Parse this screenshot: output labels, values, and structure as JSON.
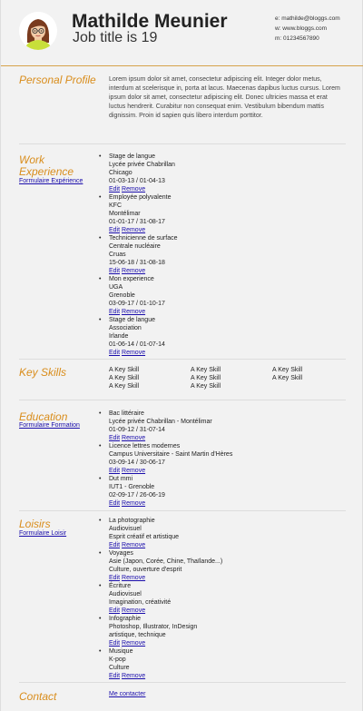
{
  "header": {
    "name": "Mathilde Meunier",
    "job_title": "Job title is 19",
    "email": "e: mathilde@bloggs.com",
    "website": "w: www.bloggs.com",
    "mobile": "m: 01234567890"
  },
  "profile": {
    "title": "Personal Profile",
    "text": "Lorem ipsum dolor sit amet, consectetur adipiscing elit. Integer dolor metus, interdum at scelerisque in, porta at lacus. Maecenas dapibus luctus cursus. Lorem ipsum dolor sit amet, consectetur adipiscing elit. Donec ultricies massa et erat luctus hendrerit. Curabitur non consequat enim. Vestibulum bibendum mattis dignissim. Proin id sapien quis libero interdum porttitor."
  },
  "experience": {
    "title_line1": "Work",
    "title_line2": "Experience",
    "form_link": "Formulaire Expérience",
    "edit_label": "Edit",
    "remove_label": "Remove",
    "items": [
      {
        "title": "Stage de langue",
        "org": "Lycée privée Chabrillan",
        "place": "Chicago",
        "dates": "01-03-13 / 01-04-13"
      },
      {
        "title": "Employée polyvalente",
        "org": "KFC",
        "place": "Montélimar",
        "dates": "01-01-17 / 31-08-17"
      },
      {
        "title": "Technicienne de surface",
        "org": "Centrale nucléaire",
        "place": "Cruas",
        "dates": "15-06-18 / 31-08-18"
      },
      {
        "title": "Mon experience",
        "org": "UGA",
        "place": "Grenoble",
        "dates": "03-09-17 / 01-10-17"
      },
      {
        "title": "Stage de langue",
        "org": "Association",
        "place": "Irlande",
        "dates": "01-06-14 / 01-07-14"
      }
    ]
  },
  "skills": {
    "title": "Key Skills",
    "items": [
      "A Key Skill",
      "A Key Skill",
      "A Key Skill",
      "A Key Skill",
      "A Key Skill",
      "A Key Skill",
      "A Key Skill",
      "A Key Skill"
    ]
  },
  "education": {
    "title": "Education",
    "form_link": "Formulaire Formation",
    "items": [
      {
        "title": "Bac littéraire",
        "school": "Lycée privée Chabrillan - Montélimar",
        "dates": "01-09-12 / 31-07-14"
      },
      {
        "title": "Licence lettres modernes",
        "school": "Campus Universitaire - Saint Martin d'Hères",
        "dates": "03-09-14 / 30-06-17"
      },
      {
        "title": "Dut mmi",
        "school": "IUT1 - Grenoble",
        "dates": "02-09-17 / 26-06-19"
      }
    ]
  },
  "loisirs": {
    "title": "Loisirs",
    "form_link": "Formulaire Loisir",
    "items": [
      {
        "title": "La photographie",
        "line2": "Audiovisuel",
        "line3": "Esprit créatif et artistique"
      },
      {
        "title": "Voyages",
        "line2": "Asie (Japon, Corée, Chine, Thaïlande...)",
        "line3": "Culture, ouverture d'esprit"
      },
      {
        "title": "Écriture",
        "line2": "Audiovisuel",
        "line3": "Imagination, créativité"
      },
      {
        "title": "Infographie",
        "line2": "Photoshop, Illustrator, InDesign",
        "line3": "artistique, technique"
      },
      {
        "title": "Musique",
        "line2": "K-pop",
        "line3": "Culture"
      }
    ]
  },
  "contact": {
    "title": "Contact",
    "link": "Me contacter"
  }
}
